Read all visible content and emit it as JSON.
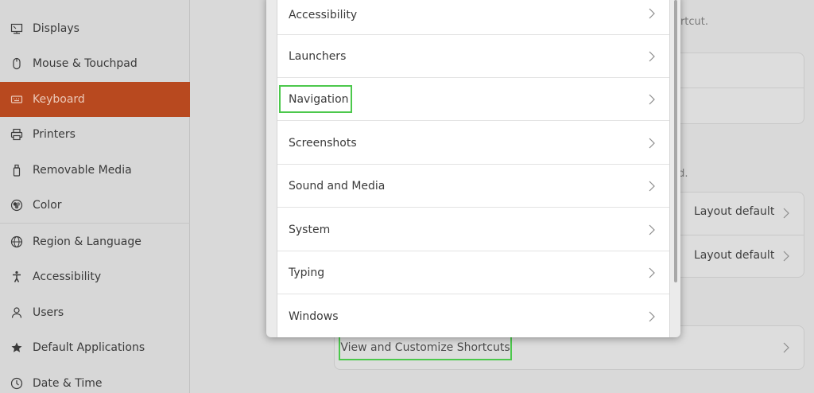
{
  "sidebar": {
    "items": [
      {
        "label": "Displays",
        "icon": "display-icon",
        "name": "sidebar-item-displays"
      },
      {
        "label": "Mouse & Touchpad",
        "icon": "mouse-icon",
        "name": "sidebar-item-mouse-touchpad"
      },
      {
        "label": "Keyboard",
        "icon": "keyboard-icon",
        "name": "sidebar-item-keyboard",
        "active": true
      },
      {
        "label": "Printers",
        "icon": "printer-icon",
        "name": "sidebar-item-printers"
      },
      {
        "label": "Removable Media",
        "icon": "usb-drive-icon",
        "name": "sidebar-item-removable-media"
      },
      {
        "label": "Color",
        "icon": "color-icon",
        "name": "sidebar-item-color"
      },
      {
        "label": "Region & Language",
        "icon": "globe-icon",
        "name": "sidebar-item-region-language"
      },
      {
        "label": "Accessibility",
        "icon": "accessibility-icon",
        "name": "sidebar-item-accessibility"
      },
      {
        "label": "Users",
        "icon": "users-icon",
        "name": "sidebar-item-users"
      },
      {
        "label": "Default Applications",
        "icon": "star-icon",
        "name": "sidebar-item-default-applications"
      },
      {
        "label": "Date & Time",
        "icon": "clock-icon",
        "name": "sidebar-item-date-time"
      }
    ]
  },
  "background": {
    "partial_text_1": "ortcut.",
    "partial_text_2": "rd.",
    "layout_default_1": "Layout default",
    "layout_default_2": "Layout default",
    "view_shortcuts_label": "View and Customize Shortcuts"
  },
  "dialog": {
    "rows": [
      {
        "label": "Accessibility"
      },
      {
        "label": "Launchers"
      },
      {
        "label": "Navigation",
        "highlighted": true
      },
      {
        "label": "Screenshots"
      },
      {
        "label": "Sound and Media"
      },
      {
        "label": "System"
      },
      {
        "label": "Typing"
      },
      {
        "label": "Windows"
      }
    ]
  },
  "colors": {
    "accent": "#b8491f",
    "highlight": "#4cc84c"
  }
}
